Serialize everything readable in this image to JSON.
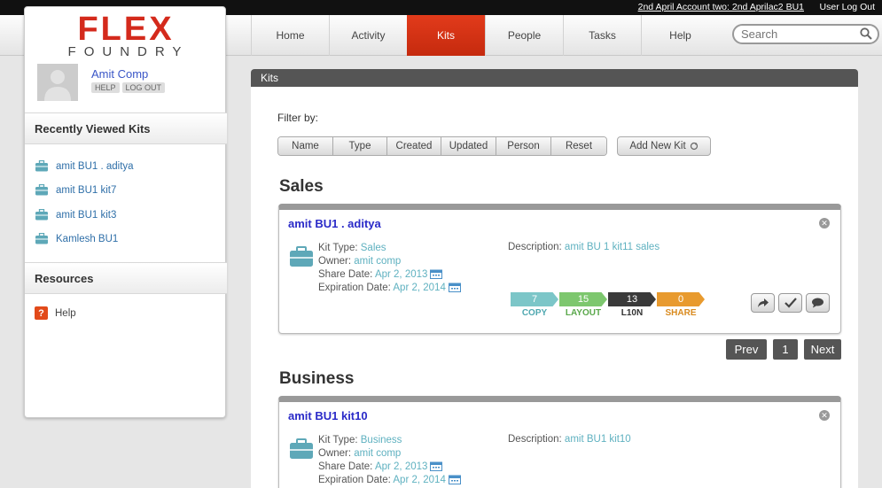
{
  "topbar": {
    "account": "2nd April Account two: 2nd Aprilac2 BU1",
    "logout": "User Log Out"
  },
  "nav": {
    "items": [
      {
        "label": "Home",
        "active": false
      },
      {
        "label": "Activity",
        "active": false
      },
      {
        "label": "Kits",
        "active": true
      },
      {
        "label": "People",
        "active": false
      },
      {
        "label": "Tasks",
        "active": false
      },
      {
        "label": "Help",
        "active": false
      }
    ],
    "search_placeholder": "Search"
  },
  "sidebar": {
    "logo_top": "FLEX",
    "logo_bottom": "FOUNDRY",
    "user_name": "Amit Comp",
    "help_btn": "HELP",
    "logout_btn": "LOG OUT",
    "recent_heading": "Recently Viewed Kits",
    "recent_kits": [
      "amit BU1 . aditya",
      "amit BU1 kit7",
      "amit BU1 kit3",
      "Kamlesh BU1"
    ],
    "resources_heading": "Resources",
    "help_link": "Help"
  },
  "main": {
    "header": "Kits",
    "filter_label": "Filter by:",
    "filters": [
      "Name",
      "Type",
      "Created",
      "Updated",
      "Person",
      "Reset"
    ],
    "add_kit": "Add New Kit",
    "sections": [
      {
        "title": "Sales",
        "card": {
          "title": "amit BU1 . aditya",
          "kit_type_label": "Kit Type:",
          "kit_type": "Sales",
          "owner_label": "Owner:",
          "owner": "amit comp",
          "share_label": "Share Date:",
          "share_date": "Apr 2, 2013",
          "exp_label": "Expiration Date:",
          "exp_date": "Apr 2, 2014",
          "desc_label": "Description:",
          "description": "amit BU 1 kit11 sales",
          "stages": [
            {
              "value": "7",
              "label": "COPY",
              "color": "#7cc6c8",
              "label_color": "#4fa8b0"
            },
            {
              "value": "15",
              "label": "LAYOUT",
              "color": "#7dc76e",
              "label_color": "#5aa84b"
            },
            {
              "value": "13",
              "label": "L10N",
              "color": "#3a3a3a",
              "label_color": "#333333"
            },
            {
              "value": "0",
              "label": "SHARE",
              "color": "#e89a2e",
              "label_color": "#d98a1e"
            }
          ]
        }
      },
      {
        "title": "Business",
        "card": {
          "title": "amit BU1 kit10",
          "kit_type_label": "Kit Type:",
          "kit_type": "Business",
          "owner_label": "Owner:",
          "owner": "amit comp",
          "share_label": "Share Date:",
          "share_date": "Apr 2, 2013",
          "exp_label": "Expiration Date:",
          "exp_date": "Apr 2, 2014",
          "desc_label": "Description:",
          "description": "amit BU1 kit10"
        }
      }
    ],
    "pager": {
      "prev": "Prev",
      "page": "1",
      "next": "Next"
    }
  }
}
